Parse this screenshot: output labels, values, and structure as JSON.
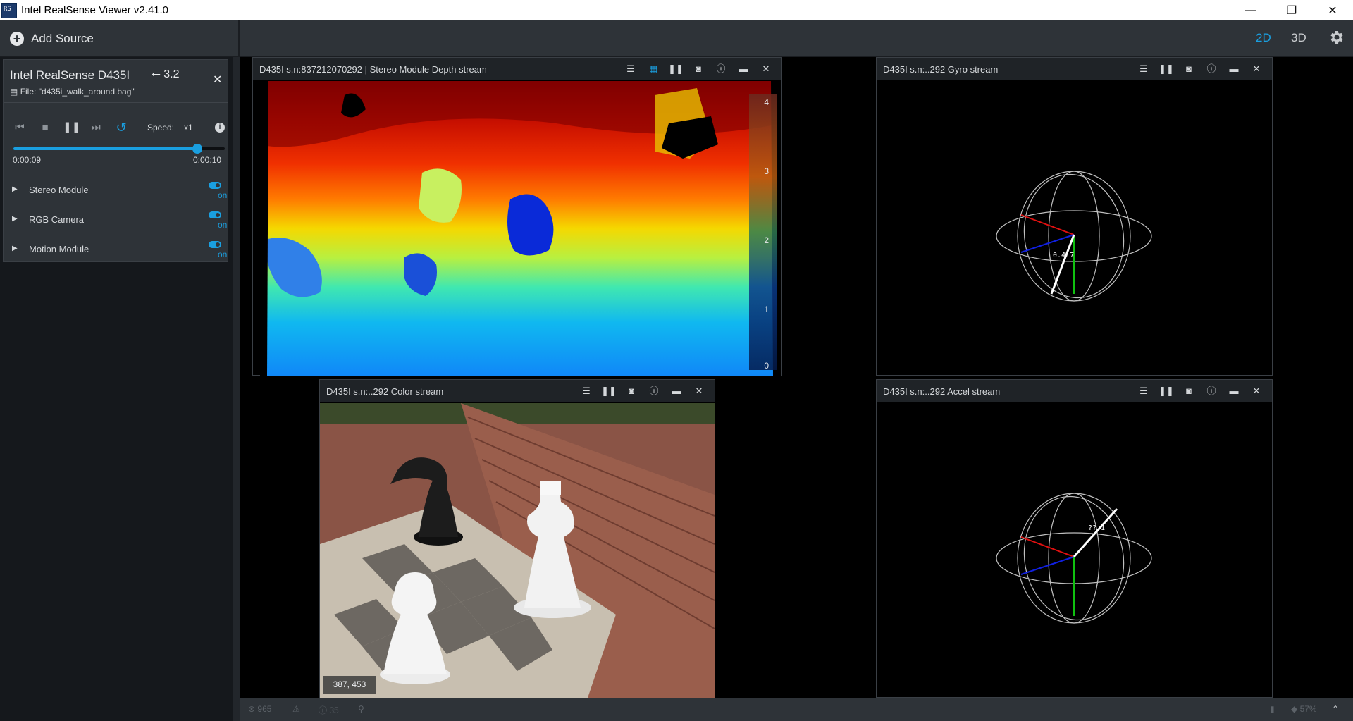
{
  "window": {
    "title": "Intel RealSense Viewer v2.41.0",
    "minimize": "—",
    "restore": "❐",
    "close": "✕"
  },
  "toolbar": {
    "add_source": "Add Source",
    "mode_2d": "2D",
    "mode_3d": "3D",
    "settings_icon": "gear-icon"
  },
  "device": {
    "name": "Intel RealSense D435I",
    "usb": "3.2",
    "file": "File: \"d435i_walk_around.bag\"",
    "speed_label": "Speed:",
    "speed_value": "x1",
    "time_current": "0:00:09",
    "time_total": "0:00:10",
    "progress": 0.87,
    "modules": [
      {
        "label": "Stereo Module",
        "state": "on"
      },
      {
        "label": "RGB Camera",
        "state": "on"
      },
      {
        "label": "Motion Module",
        "state": "on"
      }
    ]
  },
  "streams": {
    "depth": {
      "title": "D435I s.n:837212070292 | Stereo Module Depth stream",
      "scale": [
        "4",
        "3",
        "2",
        "1",
        "0"
      ]
    },
    "color": {
      "title": "D435I s.n:..292 Color stream",
      "coords": "387, 453"
    },
    "gyro": {
      "title": "D435I s.n:..292 Gyro stream",
      "value": "0.417"
    },
    "accel": {
      "title": "D435I s.n:..292 Accel stream",
      "value": "??.1"
    }
  },
  "statusbar": {
    "errors": "965",
    "infos": "35",
    "right_value": "57%"
  },
  "colors": {
    "accent": "#1a9fe0",
    "panel_bg": "#2e3338"
  }
}
